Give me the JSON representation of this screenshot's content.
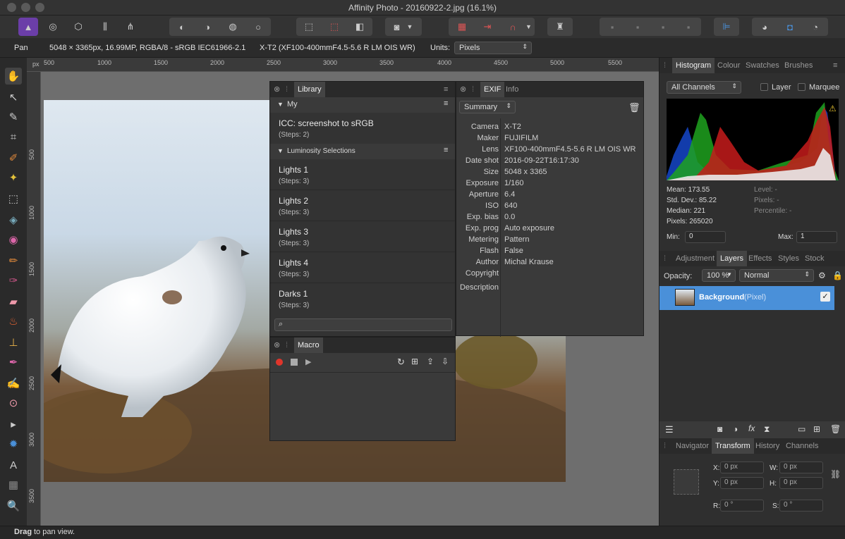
{
  "window": {
    "title": "Affinity Photo - 20160922-2.jpg (16.1%)"
  },
  "context": {
    "tool": "Pan",
    "doc_info": "5048 × 3365px, 16.99MP, RGBA/8 - sRGB IEC61966-2.1",
    "lens": "X-T2 (XF100-400mmF4.5-5.6 R LM OIS WR)",
    "units_label": "Units:",
    "units_value": "Pixels"
  },
  "ruler": {
    "unit": "px",
    "h": [
      "500",
      "1000",
      "1500",
      "2000",
      "2500",
      "3000",
      "3500",
      "4000",
      "4500",
      "5000",
      "5500"
    ],
    "v": [
      "500",
      "1000",
      "1500",
      "2000",
      "2500",
      "3000",
      "3500"
    ]
  },
  "library": {
    "tab": "Library",
    "group1": "My",
    "group2": "Luminosity Selections",
    "items1": [
      {
        "name": "ICC: screenshot to sRGB",
        "steps": "(Steps: 2)"
      }
    ],
    "items2": [
      {
        "name": "Lights 1",
        "steps": "(Steps: 3)"
      },
      {
        "name": "Lights 2",
        "steps": "(Steps: 3)"
      },
      {
        "name": "Lights 3",
        "steps": "(Steps: 3)"
      },
      {
        "name": "Lights 4",
        "steps": "(Steps: 3)"
      },
      {
        "name": "Darks 1",
        "steps": "(Steps: 3)"
      }
    ]
  },
  "macro": {
    "tab": "Macro"
  },
  "exif": {
    "tab": "EXIF",
    "tab2": "Info",
    "mode": "Summary",
    "rows": [
      {
        "k": "Camera",
        "v": "X-T2"
      },
      {
        "k": "Maker",
        "v": "FUJIFILM"
      },
      {
        "k": "Lens",
        "v": "XF100-400mmF4.5-5.6 R LM OIS WR"
      },
      {
        "k": "Date shot",
        "v": "2016-09-22T16:17:30"
      },
      {
        "k": "Size",
        "v": "5048 x 3365"
      },
      {
        "k": "Exposure",
        "v": "1/160"
      },
      {
        "k": "Aperture",
        "v": "6.4"
      },
      {
        "k": "ISO",
        "v": "640"
      },
      {
        "k": "Exp. bias",
        "v": "0.0"
      },
      {
        "k": "Exp. prog",
        "v": "Auto exposure"
      },
      {
        "k": "Metering",
        "v": "Pattern"
      },
      {
        "k": "Flash",
        "v": "False"
      },
      {
        "k": "Author",
        "v": "Michal Krause"
      },
      {
        "k": "Copyright",
        "v": ""
      },
      {
        "k": "Description",
        "v": ""
      }
    ]
  },
  "histogram": {
    "tabs": [
      "Histogram",
      "Colour",
      "Swatches",
      "Brushes"
    ],
    "channels": "All Channels",
    "layer": "Layer",
    "marquee": "Marquee",
    "mean": "Mean: 173.55",
    "std": "Std. Dev.: 85.22",
    "median": "Median: 221",
    "pixels": "Pixels: 265020",
    "level": "Level: -",
    "pixels2": "Pixels: -",
    "percentile": "Percentile: -",
    "min_label": "Min:",
    "min": "0",
    "max_label": "Max:",
    "max": "1"
  },
  "layers": {
    "tabs": [
      "Adjustment",
      "Layers",
      "Effects",
      "Styles",
      "Stock"
    ],
    "opacity_label": "Opacity:",
    "opacity": "100 %",
    "blend": "Normal",
    "layer_name": "Background",
    "layer_type": "(Pixel)"
  },
  "transform": {
    "tabs": [
      "Navigator",
      "Transform",
      "History",
      "Channels"
    ],
    "x": "0 px",
    "y": "0 px",
    "w": "0 px",
    "h": "0 px",
    "r": "0 °",
    "s": "0 °",
    "x_label": "X:",
    "y_label": "Y:",
    "w_label": "W:",
    "h_label": "H:",
    "r_label": "R:",
    "s_label": "S:"
  },
  "status": {
    "bold": "Drag",
    "rest": " to pan view."
  },
  "colors": {
    "accent": "#4a90d9",
    "record": "#e0352b"
  }
}
